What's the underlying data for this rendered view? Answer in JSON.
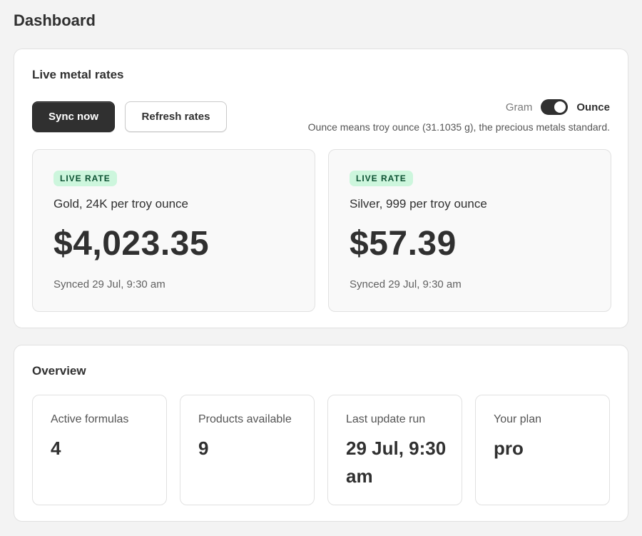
{
  "page": {
    "title": "Dashboard"
  },
  "rates_card": {
    "title": "Live metal rates",
    "sync_button": "Sync now",
    "refresh_button": "Refresh rates",
    "unit_toggle": {
      "off_label": "Gram",
      "on_label": "Ounce",
      "selected": "Ounce"
    },
    "unit_note": "Ounce means troy ounce (31.1035 g), the precious metals standard.",
    "rates": [
      {
        "badge": "LIVE RATE",
        "name": "Gold, 24K per troy ounce",
        "price": "$4,023.35",
        "synced": "Synced 29 Jul, 9:30 am"
      },
      {
        "badge": "LIVE RATE",
        "name": "Silver, 999 per troy ounce",
        "price": "$57.39",
        "synced": "Synced 29 Jul, 9:30 am"
      }
    ]
  },
  "overview": {
    "title": "Overview",
    "stats": [
      {
        "label": "Active formulas",
        "value": "4"
      },
      {
        "label": "Products available",
        "value": "9"
      },
      {
        "label": "Last update run",
        "value": "29 Jul, 9:30 am"
      },
      {
        "label": "Your plan",
        "value": "pro"
      }
    ]
  },
  "colors": {
    "badge_bg": "#cdf6dd",
    "badge_text": "#0c5132",
    "primary_button": "#303030"
  }
}
